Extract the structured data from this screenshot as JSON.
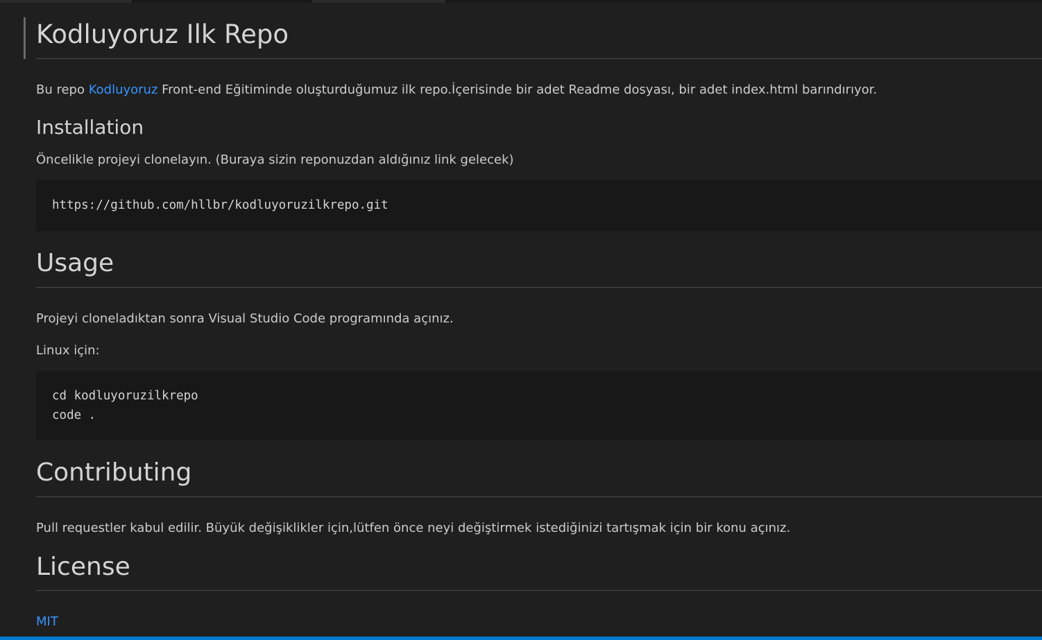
{
  "document": {
    "title": "Kodluyoruz Ilk Repo",
    "intro": {
      "before_link": "Bu repo ",
      "link_text": "Kodluyoruz",
      "after_link": " Front-end Eğitiminde oluşturduğumuz ilk repo.İçerisinde bir adet Readme dosyası, bir adet index.html barındırıyor."
    },
    "installation": {
      "heading": "Installation",
      "text": "Öncelikle projeyi clonelayın. (Buraya sizin reponuzdan aldığınız link gelecek)",
      "code_lines": [
        "https://github.com/hllbr/kodluyoruzilkrepo.git"
      ]
    },
    "usage": {
      "heading": "Usage",
      "text1": "Projeyi cloneladıktan sonra Visual Studio Code programında açınız.",
      "text2": "Linux için:",
      "code_lines": [
        "cd kodluyoruzilkrepo",
        "code ."
      ]
    },
    "contributing": {
      "heading": "Contributing",
      "text": "Pull requestler kabul edilir. Büyük değişiklikler için,lütfen önce neyi değiştirmek istediğinizi tartışmak için bir konu açınız."
    },
    "license": {
      "heading": "License",
      "link_text": "MIT"
    }
  },
  "colors": {
    "background": "#1f1f1f",
    "text": "#cccccc",
    "link": "#3794ff",
    "code_background": "#181818",
    "statusbar": "#007acc"
  }
}
